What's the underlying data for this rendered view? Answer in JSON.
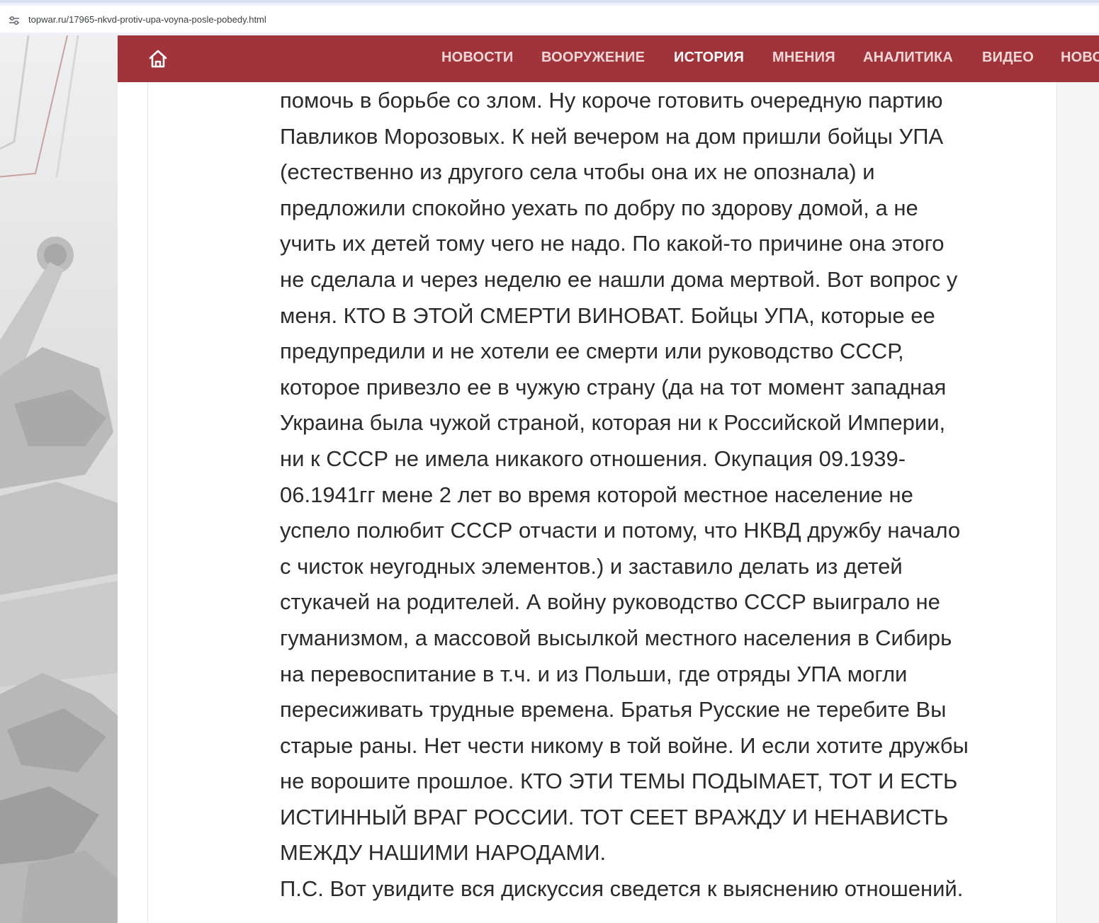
{
  "browser": {
    "url": "topwar.ru/17965-nkvd-protiv-upa-voyna-posle-pobedy.html"
  },
  "nav": {
    "items": [
      {
        "label": "НОВОСТИ",
        "active": false
      },
      {
        "label": "ВООРУЖЕНИЕ",
        "active": false
      },
      {
        "label": "ИСТОРИЯ",
        "active": true
      },
      {
        "label": "МНЕНИЯ",
        "active": false
      },
      {
        "label": "АНАЛИТИКА",
        "active": false
      },
      {
        "label": "ВИДЕО",
        "active": false
      },
      {
        "label": "НОВОСТИ",
        "active": false
      }
    ]
  },
  "comment": {
    "lines": [
      "помочь в борьбе со злом. Ну короче готовить очередную партию",
      "Павликов Морозовых. К ней вечером на дом пришли бойцы УПА",
      "(естественно из другого села чтобы она их не опознала) и",
      "предложили спокойно уехать по добру по здорову домой, а не",
      "учить их детей тому чего не надо. По какой-то причине она этого",
      "не сделала и через неделю ее нашли дома мертвой. Вот вопрос у",
      "меня. КТО В ЭТОЙ СМЕРТИ ВИНОВАТ. Бойцы УПА, которые ее",
      "предупредили и не хотели ее смерти или руководство СССР,",
      "которое привезло ее в чужую страну (да на тот момент западная",
      "Украина была чужой страной, которая ни к Российской Империи,",
      "ни к СССР не имела никакого отношения. Окупация 09.1939-",
      "06.1941гг мене 2 лет во время которой местное население не",
      "успело полюбит СССР отчасти и потому, что НКВД дружбу начало",
      "с чисток неугодных элементов.) и заставило делать из детей",
      "стукачей на родителей. А войну руководство СССР выиграло не",
      "гуманизмом, а массовой высылкой местного населения в Сибирь",
      "на перевоспитание в т.ч. и из Польши, где отряды УПА могли",
      "пересиживать трудные времена. Братья Русские не теребите Вы",
      "старые раны. Нет чести никому в той войне. И если хотите дружбы",
      "не ворошите прошлое. КТО ЭТИ ТЕМЫ ПОДЫМАЕТ, ТОТ И ЕСТЬ",
      "ИСТИННЫЙ ВРАГ РОССИИ. ТОТ СЕЕТ ВРАЖДУ И НЕНАВИСТЬ",
      "МЕЖДУ НАШИМИ НАРОДАМИ.",
      "П.С. Вот увидите вся дискуссия сведется к выяснению отношений."
    ]
  },
  "colors": {
    "nav_background": "#a0343a",
    "nav_text": "#f3d7d8",
    "nav_active_text": "#ffffff",
    "body_text": "#2b2b2b"
  },
  "icons": {
    "site_info": "tune-icon",
    "home": "home-icon"
  }
}
